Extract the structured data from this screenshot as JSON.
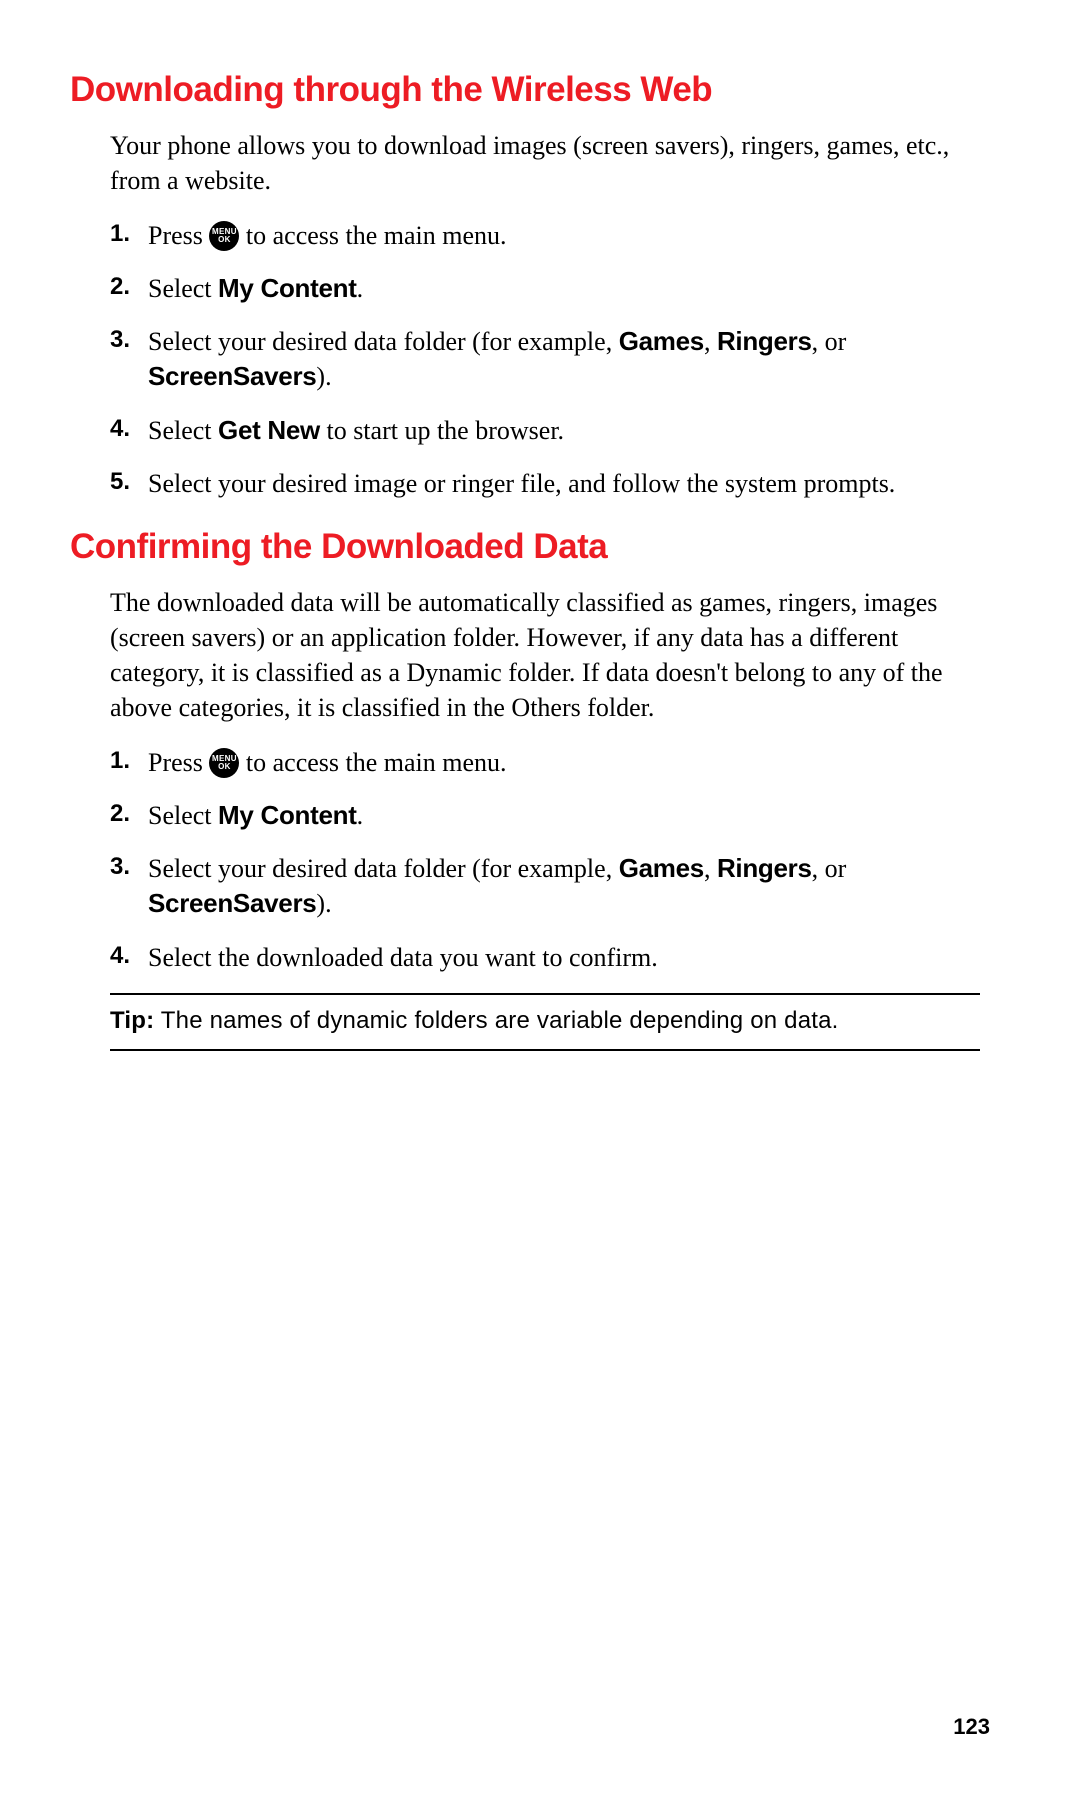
{
  "icon": {
    "line1": "MENU",
    "line2": "OK"
  },
  "section1": {
    "heading": "Downloading through the Wireless Web",
    "intro": "Your phone allows you to download images (screen savers), ringers, games, etc., from a website.",
    "steps": {
      "s1_pre": "Press ",
      "s1_post": " to access the main menu.",
      "s2_pre": "Select ",
      "s2_b1": "My Content",
      "s2_post": ".",
      "s3_pre": "Select your desired data folder (for example, ",
      "s3_b1": "Games",
      "s3_mid1": ", ",
      "s3_b2": "Ringers",
      "s3_mid2": ", or ",
      "s3_b3": "ScreenSavers",
      "s3_post": ").",
      "s4_pre": "Select ",
      "s4_b1": "Get New",
      "s4_post": " to start up the browser.",
      "s5": "Select your desired image or ringer file, and follow the system prompts."
    }
  },
  "section2": {
    "heading": "Confirming the Downloaded Data",
    "intro": "The downloaded data will be automatically classified as games, ringers, images (screen savers) or an application folder. However, if any data has a different category, it is classified as a Dynamic folder. If data doesn't belong to any of the above categories, it is classified in the Others folder.",
    "steps": {
      "s1_pre": "Press ",
      "s1_post": " to access the main menu.",
      "s2_pre": "Select ",
      "s2_b1": "My Content",
      "s2_post": ".",
      "s3_pre": "Select your desired data folder (for example, ",
      "s3_b1": "Games",
      "s3_mid1": ", ",
      "s3_b2": "Ringers",
      "s3_mid2": ", or ",
      "s3_b3": "ScreenSavers",
      "s3_post": ").",
      "s4": "Select the downloaded data you want to confirm."
    }
  },
  "tip": {
    "label": "Tip:",
    "text": " The names of dynamic folders are variable depending on data."
  },
  "page_number": "123"
}
